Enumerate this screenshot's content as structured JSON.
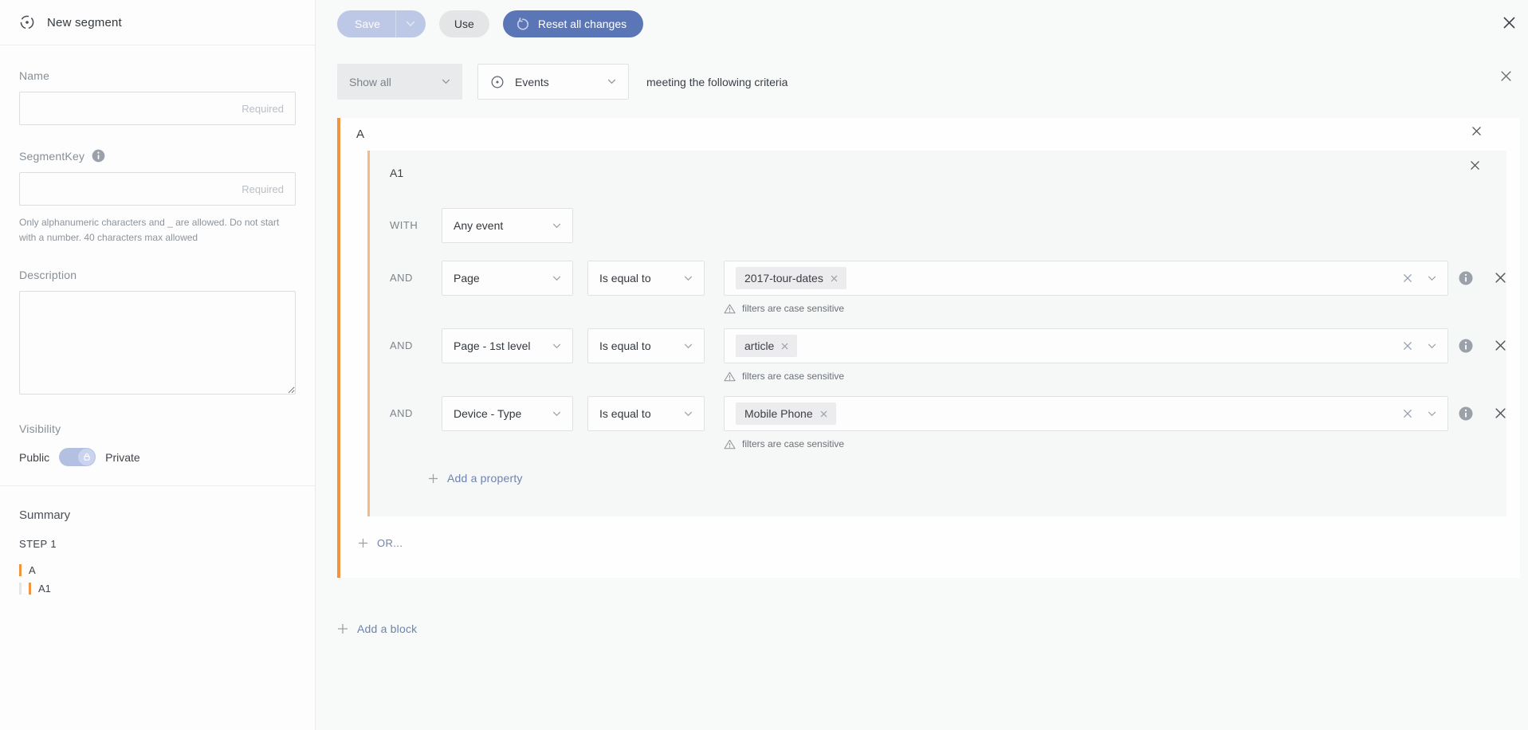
{
  "sidebar": {
    "title": "New segment",
    "name_label": "Name",
    "name_placeholder": "Required",
    "segmentkey_label": "SegmentKey",
    "segmentkey_placeholder": "Required",
    "segmentkey_help": "Only alphanumeric characters and _ are allowed. Do not start with a number. 40 characters max allowed",
    "description_label": "Description",
    "visibility_label": "Visibility",
    "visibility_public": "Public",
    "visibility_private": "Private",
    "summary_title": "Summary",
    "summary_step": "STEP 1",
    "summary_items": [
      {
        "label": "A",
        "level": 1
      },
      {
        "label": "A1",
        "level": 2
      }
    ]
  },
  "toolbar": {
    "save_label": "Save",
    "use_label": "Use",
    "reset_label": "Reset all changes"
  },
  "criteria_bar": {
    "scope_value": "Show all",
    "type_value": "Events",
    "suffix_text": "meeting the following criteria"
  },
  "block": {
    "label": "A",
    "sub_label": "A1",
    "rows": [
      {
        "connector": "WITH",
        "field": "Any event"
      },
      {
        "connector": "AND",
        "field": "Page",
        "operator": "Is equal to",
        "value": "2017-tour-dates",
        "warning": "filters are case sensitive"
      },
      {
        "connector": "AND",
        "field": "Page - 1st level",
        "operator": "Is equal to",
        "value": "article",
        "warning": "filters are case sensitive"
      },
      {
        "connector": "AND",
        "field": "Device - Type",
        "operator": "Is equal to",
        "value": "Mobile Phone",
        "warning": "filters are case sensitive"
      }
    ],
    "add_property_label": "Add a property",
    "or_label": "OR..."
  },
  "add_block_label": "Add a block",
  "icons": {
    "segment-icon": "dashed-circle-with-dot",
    "events-icon": "circle-with-dot",
    "info-icon": "i-in-filled-circle",
    "chevron-down-icon": "⌄",
    "close-icon": "✕",
    "warning-icon": "⚠",
    "reset-icon": "↺",
    "plus-icon": "+",
    "lock-icon": "padlock"
  },
  "colors": {
    "accent_orange": "#F2933F",
    "accent_orange_light": "#F3BC86",
    "primary_button_blue": "#5B76B7",
    "disabled_button_blue": "#BCC8E5",
    "toggle_track_blue": "#B3C0E2",
    "link_blue": "#6D83AE",
    "chip_gray": "#ECECEE"
  }
}
